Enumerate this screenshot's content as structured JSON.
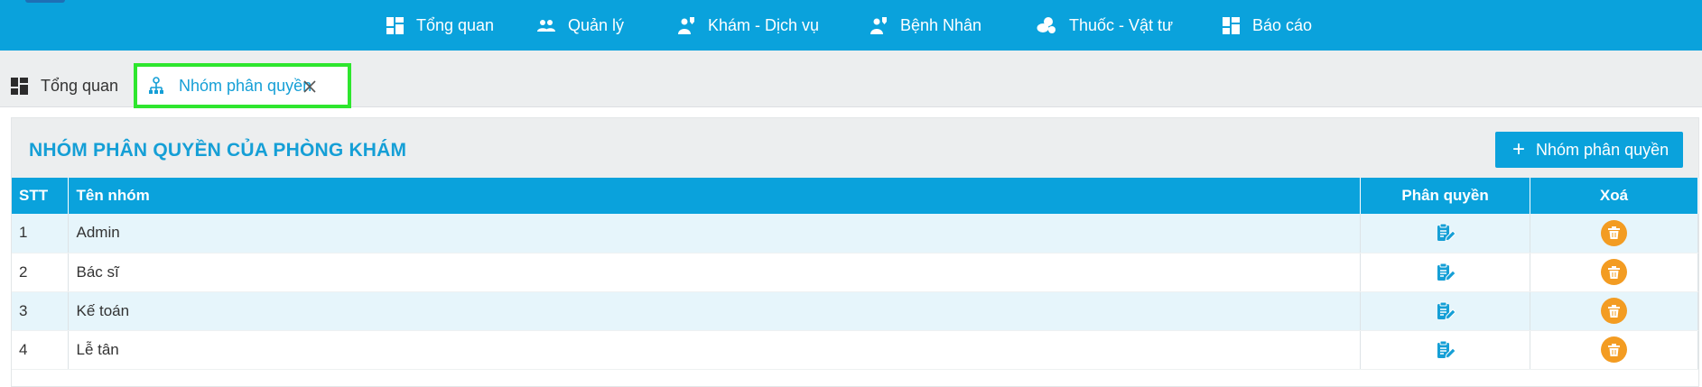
{
  "nav": {
    "items": [
      {
        "label": "Tổng quan",
        "icon": "dashboard-icon"
      },
      {
        "label": "Quản lý",
        "icon": "people-icon"
      },
      {
        "label": "Khám - Dịch vụ",
        "icon": "doctor-icon"
      },
      {
        "label": "Bệnh Nhân",
        "icon": "patient-icon"
      },
      {
        "label": "Thuốc - Vật tư",
        "icon": "pills-icon"
      },
      {
        "label": "Báo cáo",
        "icon": "dashboard-icon"
      }
    ]
  },
  "tabs": {
    "home_label": "Tổng quan",
    "active_label": "Nhóm phân quyền"
  },
  "panel": {
    "title": "NHÓM PHÂN QUYỀN CỦA PHÒNG KHÁM",
    "add_button_label": "Nhóm phân quyền"
  },
  "table": {
    "headers": {
      "stt": "STT",
      "name": "Tên nhóm",
      "perm": "Phân quyền",
      "delete": "Xoá"
    },
    "rows": [
      {
        "stt": "1",
        "name": "Admin"
      },
      {
        "stt": "2",
        "name": "Bác sĩ"
      },
      {
        "stt": "3",
        "name": "Kế toán"
      },
      {
        "stt": "4",
        "name": "Lễ tân"
      }
    ]
  },
  "colors": {
    "primary": "#0aa2dc",
    "highlight_border": "#2ee62e",
    "delete": "#f39c22"
  }
}
